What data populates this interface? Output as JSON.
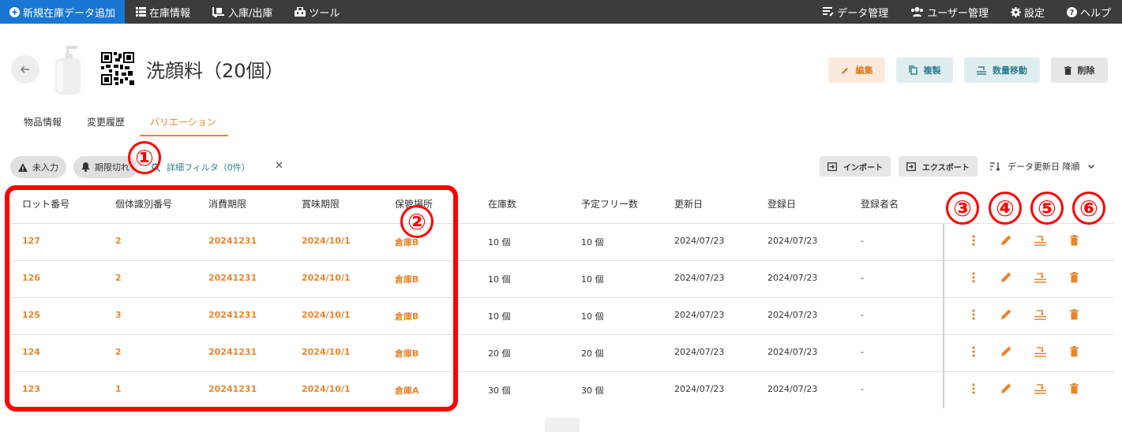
{
  "nav": {
    "add_label": "新規在庫データ追加",
    "stock_info": "在庫情報",
    "in_out": "入庫/出庫",
    "tools": "ツール",
    "data_mgmt": "データ管理",
    "user_mgmt": "ユーザー管理",
    "settings": "設定",
    "help": "ヘルプ"
  },
  "colors": {
    "nav_bg": "#3c3c3c",
    "primary": "#1976d2",
    "accent": "#e8862b",
    "teal": "#2d7f8c",
    "annotation": "#ff0000"
  },
  "item": {
    "title": "洗顔料（20個）"
  },
  "header_buttons": {
    "edit": "編集",
    "copy": "複製",
    "move": "数量移動",
    "delete": "削除"
  },
  "tabs": [
    {
      "label": "物品情報"
    },
    {
      "label": "変更履歴"
    },
    {
      "label": "バリエーション",
      "active": true
    }
  ],
  "filters": {
    "missing": "未入力",
    "expired": "期限切れ",
    "detail": "詳細フィルタ（0件）",
    "clear": "✕"
  },
  "toolbar": {
    "import": "インポート",
    "export": "エクスポート",
    "sort": "データ更新日 降順"
  },
  "table": {
    "columns": [
      "ロット番号",
      "個体識別番号",
      "消費期限",
      "賞味期限",
      "保管場所",
      "在庫数",
      "予定フリー数",
      "更新日",
      "登録日",
      "登録者名"
    ],
    "rows": [
      [
        "127",
        "2",
        "20241231",
        "2024/10/1",
        "倉庫B",
        "10 個",
        "10 個",
        "2024/07/23",
        "2024/07/23",
        "-"
      ],
      [
        "126",
        "2",
        "20241231",
        "2024/10/1",
        "倉庫B",
        "10 個",
        "10 個",
        "2024/07/23",
        "2024/07/23",
        "-"
      ],
      [
        "125",
        "3",
        "20241231",
        "2024/10/1",
        "倉庫B",
        "10 個",
        "10 個",
        "2024/07/23",
        "2024/07/23",
        "-"
      ],
      [
        "124",
        "2",
        "20241231",
        "2024/10/1",
        "倉庫B",
        "20 個",
        "20 個",
        "2024/07/23",
        "2024/07/23",
        "-"
      ],
      [
        "123",
        "1",
        "20241231",
        "2024/10/1",
        "倉庫A",
        "30 個",
        "30 個",
        "2024/07/23",
        "2024/07/23",
        "-"
      ]
    ],
    "row_actions": [
      "more-vert-icon",
      "edit-icon",
      "move-icon",
      "delete-icon"
    ]
  },
  "annotations": [
    "①",
    "②",
    "③",
    "④",
    "⑤",
    "⑥"
  ]
}
